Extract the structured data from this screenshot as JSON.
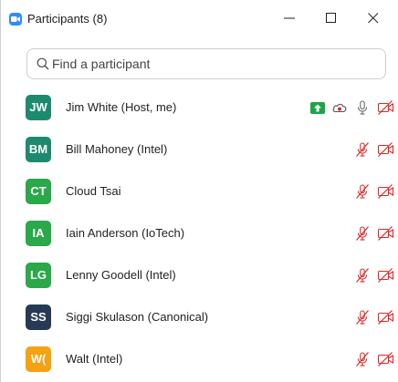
{
  "window": {
    "title": "Participants (8)"
  },
  "search": {
    "placeholder": "Find a participant",
    "value": ""
  },
  "colors": {
    "zoom_blue": "#2d8cff",
    "muted_red": "#e02828",
    "share_green": "#1fa347"
  },
  "participants": [
    {
      "initials": "JW",
      "name": "Jim White (Host, me)",
      "avatar_color": "#1e8a6d",
      "icons": [
        "screen-share-icon",
        "recording-cloud-icon",
        "microphone-icon",
        "video-off-icon"
      ]
    },
    {
      "initials": "BM",
      "name": "Bill Mahoney (Intel)",
      "avatar_color": "#1e8a6d",
      "icons": [
        "microphone-muted-icon",
        "video-off-icon"
      ]
    },
    {
      "initials": "CT",
      "name": "Cloud Tsai",
      "avatar_color": "#2aa84a",
      "icons": [
        "microphone-muted-icon",
        "video-off-icon"
      ]
    },
    {
      "initials": "IA",
      "name": "Iain Anderson (IoTech)",
      "avatar_color": "#2aa84a",
      "icons": [
        "microphone-muted-icon",
        "video-off-icon"
      ]
    },
    {
      "initials": "LG",
      "name": "Lenny Goodell (Intel)",
      "avatar_color": "#2aa84a",
      "icons": [
        "microphone-muted-icon",
        "video-off-icon"
      ]
    },
    {
      "initials": "SS",
      "name": "Siggi Skulason (Canonical)",
      "avatar_color": "#263a55",
      "icons": [
        "microphone-muted-icon",
        "video-off-icon"
      ]
    },
    {
      "initials": "W(",
      "name": "Walt (Intel)",
      "avatar_color": "#f5a212",
      "icons": [
        "microphone-muted-icon",
        "video-off-icon"
      ]
    }
  ]
}
